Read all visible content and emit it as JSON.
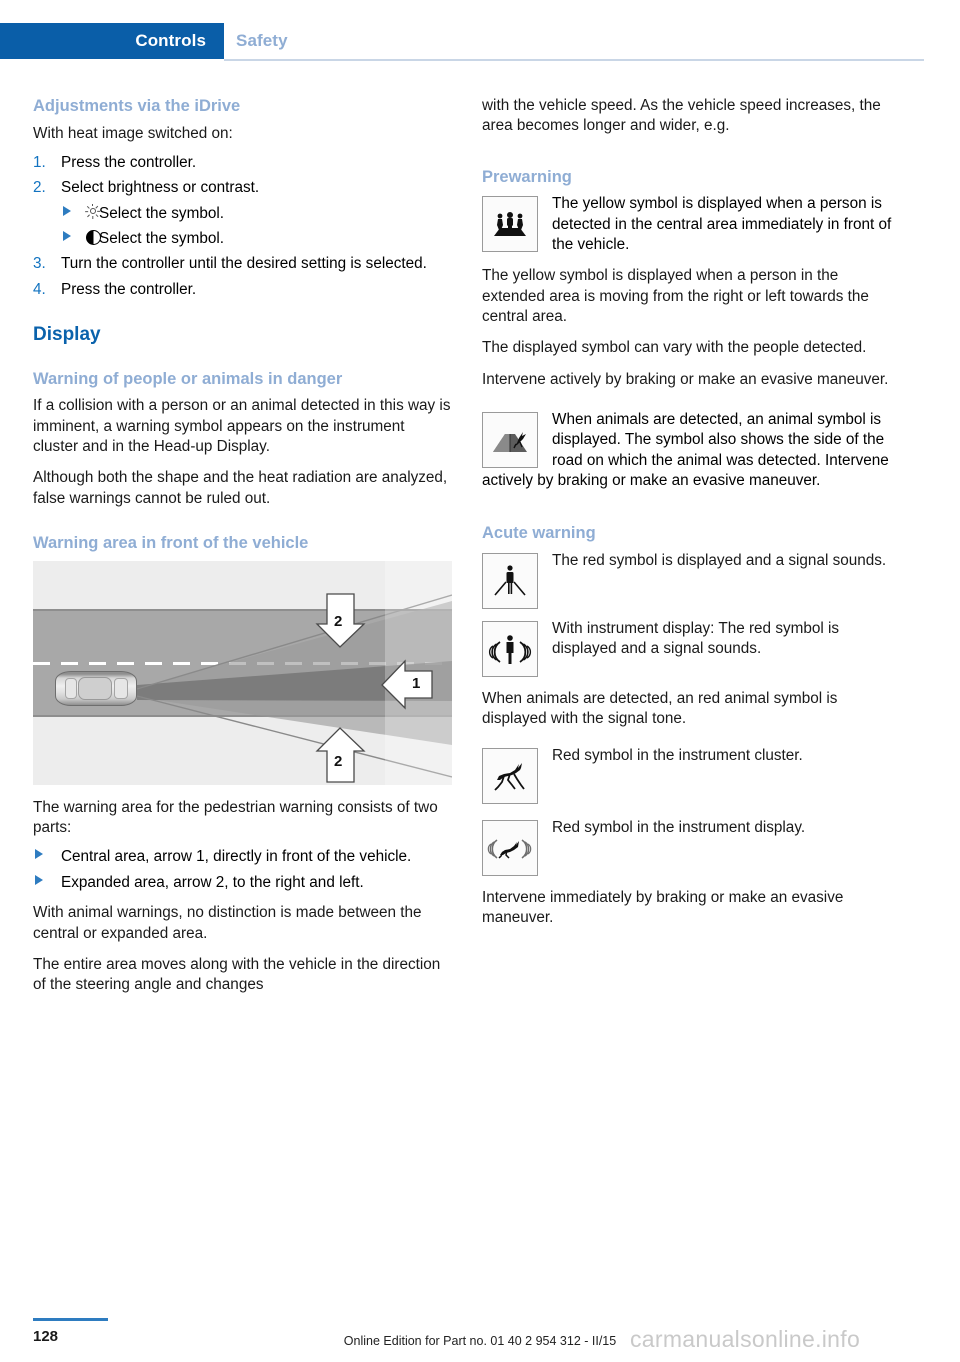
{
  "header": {
    "active_tab": "Controls",
    "inactive_tab": "Safety",
    "accent_blue": "#0A5EA8",
    "muted_blue": "#8FADD4"
  },
  "left_column": {
    "heading_idrive": "Adjustments via the iDrive",
    "intro": "With heat image switched on:",
    "steps": [
      {
        "num": "1.",
        "text": "Press the controller."
      },
      {
        "num": "2.",
        "text": "Select brightness or contrast."
      },
      {
        "num": "3.",
        "text": "Turn the controller until the desired setting is selected."
      },
      {
        "num": "4.",
        "text": "Press the controller."
      }
    ],
    "substeps": [
      {
        "symbol": "brightness-sun-icon",
        "text": "Select the symbol."
      },
      {
        "symbol": "contrast-half-circle-icon",
        "text": "Select the symbol."
      }
    ],
    "heading_display": "Display",
    "heading_warning_people": "Warning of people or animals in danger",
    "para_collision": "If a collision with a person or an animal detected in this way is imminent, a warning symbol appears on the instrument cluster and in the Head-up Display.",
    "para_shape": "Although both the shape and the heat radiation are analyzed, false warnings cannot be ruled out.",
    "heading_warning_area": "Warning area in front of the vehicle",
    "figure": {
      "name": "warning-area-diagram",
      "labels": [
        "2",
        "1",
        "2"
      ]
    },
    "para_warning_area": "The warning area for the pedestrian warning consists of two parts:",
    "area_bullets": [
      "Central area, arrow 1, directly in front of the vehicle.",
      "Expanded area, arrow 2, to the right and left."
    ],
    "para_animal_no_distinction": "With animal warnings, no distinction is made between the central or expanded area.",
    "para_entire_area": "The entire area moves along with the vehicle in the direction of the steering angle and changes"
  },
  "right_column": {
    "para_continuation": "with the vehicle speed. As the vehicle speed increases, the area becomes longer and wider, e.g.",
    "heading_prewarning": "Prewarning",
    "sym_prewarning_people": {
      "icon": "three-pedestrians-icon",
      "text": "The yellow symbol is displayed when a person is detected in the central area immediately in front of the vehicle."
    },
    "para_yellow_extended": "The yellow symbol is displayed when a person in the extended area is moving from the right or left towards the central area.",
    "para_symbol_vary": "The displayed symbol can vary with the people detected.",
    "para_intervene_evasive": "Intervene actively by braking or make an evasive maneuver.",
    "sym_animal": {
      "icon": "animal-road-side-icon",
      "text": "When animals are detected, an animal symbol is displayed. The symbol also shows the side of the road on which the animal was detected. Intervene actively by braking or make an evasive maneuver."
    },
    "heading_acute": "Acute warning",
    "sym_acute_person": {
      "icon": "pedestrian-warning-icon",
      "text": "The red symbol is displayed and a signal sounds."
    },
    "sym_acute_display": {
      "icon": "pedestrian-signal-icon",
      "text": "With instrument display: The red symbol is displayed and a signal sounds."
    },
    "para_animal_red": "When animals are detected, an red animal symbol is displayed with the signal tone.",
    "sym_deer_cluster": {
      "icon": "deer-icon",
      "text": "Red symbol in the instrument cluster."
    },
    "sym_deer_display": {
      "icon": "deer-signal-icon",
      "text": "Red symbol in the instrument display."
    },
    "para_intervene_immediately": "Intervene immediately by braking or make an evasive maneuver."
  },
  "footer": {
    "page_number": "128",
    "edition": "Online Edition for Part no. 01 40 2 954 312 - II/15",
    "watermark": "carmanualsonline.info"
  }
}
